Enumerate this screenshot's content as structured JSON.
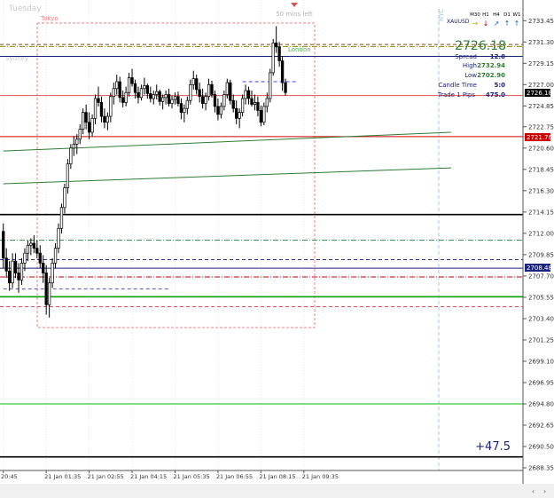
{
  "window": {
    "title": "Tuesday"
  },
  "sessions": [
    {
      "name": "Tokyo",
      "label": "Tokyo"
    },
    {
      "name": "Sydney",
      "label": "Sydney"
    },
    {
      "name": "London",
      "label": "London"
    },
    {
      "name": "NY",
      "label": "NYC"
    }
  ],
  "timer_text": "50 mins left",
  "symbol": "XAUUSD",
  "timeframes": [
    "M30",
    "H1",
    "H4",
    "D1",
    "W1"
  ],
  "timeframe_arrows": [
    "right",
    "down",
    "up-right",
    "up",
    "up"
  ],
  "info_panel": {
    "price": "2726.18",
    "rows": [
      {
        "label": "Spread",
        "value": "12.0"
      },
      {
        "label": "High",
        "value": "2732.94"
      },
      {
        "label": "Low",
        "value": "2702.90"
      },
      {
        "label": "Candle Time",
        "value": "5:0"
      },
      {
        "label": "Trade 1 Pips",
        "value": "475.0"
      }
    ]
  },
  "pnl_text": "+47.5",
  "current_price_label": "2726.18",
  "red_line_label": "2721.76",
  "blue_line_label": "2708.48",
  "colors": {
    "bull": "#000000",
    "bear": "#000000",
    "price_up": "#2e7d32",
    "axis_text": "#333333",
    "session_box": "#f08080",
    "current_price_bg": "#000000",
    "red_tag": "#cc0000",
    "navy_tag": "#1a237e",
    "nyc_line": "#9ecae1"
  },
  "chart_data": {
    "type": "candlestick",
    "symbol": "XAUUSD",
    "timeframe": "M5",
    "ylim": [
      2688.35,
      2735.0
    ],
    "y_ticks": [
      2733.45,
      2731.3,
      2729.15,
      2727.0,
      2724.85,
      2722.75,
      2720.6,
      2718.45,
      2716.3,
      2714.15,
      2712.0,
      2709.85,
      2707.7,
      2705.55,
      2703.4,
      2701.25,
      2699.1,
      2696.95,
      2694.8,
      2692.65,
      2690.5,
      2688.35
    ],
    "x_tick_labels": [
      "20:45",
      "21 Jan 01:35",
      "21 Jan 02:55",
      "21 Jan 04:15",
      "21 Jan 05:35",
      "21 Jan 06:55",
      "21 Jan 08:15",
      "21 Jan 09:35"
    ],
    "x_tick_bars": [
      0,
      14,
      28,
      42,
      56,
      70,
      84,
      98
    ],
    "candles": [
      [
        2712.2,
        2713.0,
        2708.5,
        2709.5
      ],
      [
        2709.5,
        2710.5,
        2707.5,
        2708.2
      ],
      [
        2708.2,
        2709.2,
        2706.2,
        2707.0
      ],
      [
        2707.0,
        2710.0,
        2706.5,
        2709.2
      ],
      [
        2709.2,
        2710.0,
        2707.5,
        2708.0
      ],
      [
        2708.0,
        2709.0,
        2706.0,
        2707.3
      ],
      [
        2707.3,
        2709.5,
        2706.8,
        2709.0
      ],
      [
        2709.0,
        2710.5,
        2708.2,
        2710.0
      ],
      [
        2710.0,
        2711.3,
        2709.2,
        2710.8
      ],
      [
        2710.8,
        2711.5,
        2709.8,
        2711.0
      ],
      [
        2711.0,
        2711.8,
        2710.0,
        2710.5
      ],
      [
        2710.5,
        2711.3,
        2709.5,
        2710.0
      ],
      [
        2710.0,
        2710.8,
        2708.5,
        2709.0
      ],
      [
        2709.0,
        2709.8,
        2707.0,
        2708.0
      ],
      [
        2708.0,
        2708.8,
        2703.8,
        2704.8
      ],
      [
        2704.8,
        2707.5,
        2703.5,
        2707.0
      ],
      [
        2707.0,
        2709.5,
        2706.5,
        2709.0
      ],
      [
        2709.0,
        2711.0,
        2708.5,
        2710.5
      ],
      [
        2710.5,
        2713.0,
        2710.0,
        2712.5
      ],
      [
        2712.5,
        2715.0,
        2712.0,
        2714.6
      ],
      [
        2714.6,
        2717.0,
        2714.0,
        2716.6
      ],
      [
        2716.6,
        2719.5,
        2716.0,
        2719.0
      ],
      [
        2719.0,
        2721.0,
        2718.5,
        2720.6
      ],
      [
        2720.6,
        2721.8,
        2719.8,
        2721.0
      ],
      [
        2721.0,
        2722.0,
        2720.0,
        2721.5
      ],
      [
        2721.5,
        2723.0,
        2721.0,
        2722.5
      ],
      [
        2722.5,
        2724.6,
        2722.0,
        2724.2
      ],
      [
        2724.2,
        2725.0,
        2722.5,
        2723.2
      ],
      [
        2723.2,
        2724.2,
        2721.5,
        2722.2
      ],
      [
        2722.2,
        2724.0,
        2721.8,
        2723.6
      ],
      [
        2723.6,
        2726.0,
        2723.0,
        2725.6
      ],
      [
        2725.6,
        2726.8,
        2724.8,
        2725.2
      ],
      [
        2725.2,
        2725.8,
        2723.2,
        2723.8
      ],
      [
        2723.8,
        2724.6,
        2722.6,
        2723.2
      ],
      [
        2723.2,
        2724.2,
        2722.4,
        2723.8
      ],
      [
        2723.8,
        2726.2,
        2723.2,
        2725.8
      ],
      [
        2725.8,
        2727.2,
        2725.0,
        2726.6
      ],
      [
        2726.6,
        2728.0,
        2726.0,
        2727.3
      ],
      [
        2727.3,
        2727.8,
        2725.2,
        2725.7
      ],
      [
        2725.7,
        2726.4,
        2724.7,
        2725.2
      ],
      [
        2725.2,
        2726.8,
        2724.8,
        2726.2
      ],
      [
        2726.2,
        2728.2,
        2725.8,
        2727.7
      ],
      [
        2727.7,
        2728.6,
        2726.8,
        2727.1
      ],
      [
        2727.1,
        2727.5,
        2725.6,
        2726.2
      ],
      [
        2726.2,
        2726.8,
        2725.1,
        2725.7
      ],
      [
        2725.7,
        2727.0,
        2725.4,
        2726.6
      ],
      [
        2726.6,
        2727.7,
        2726.0,
        2726.9
      ],
      [
        2726.9,
        2727.1,
        2725.6,
        2726.1
      ],
      [
        2726.1,
        2726.8,
        2725.2,
        2725.6
      ],
      [
        2725.6,
        2726.4,
        2725.0,
        2726.0
      ],
      [
        2726.0,
        2727.0,
        2725.5,
        2726.3
      ],
      [
        2726.3,
        2726.5,
        2724.9,
        2725.3
      ],
      [
        2725.3,
        2726.0,
        2724.5,
        2725.7
      ],
      [
        2725.7,
        2726.4,
        2725.0,
        2726.0
      ],
      [
        2726.0,
        2726.6,
        2724.8,
        2725.1
      ],
      [
        2725.1,
        2725.9,
        2724.6,
        2725.5
      ],
      [
        2725.5,
        2726.2,
        2725.0,
        2725.8
      ],
      [
        2725.8,
        2726.3,
        2724.8,
        2725.1
      ],
      [
        2725.1,
        2725.6,
        2723.5,
        2724.2
      ],
      [
        2724.2,
        2725.0,
        2723.2,
        2724.6
      ],
      [
        2724.6,
        2725.8,
        2724.0,
        2725.4
      ],
      [
        2725.4,
        2727.5,
        2725.0,
        2727.0
      ],
      [
        2727.0,
        2728.4,
        2726.5,
        2727.6
      ],
      [
        2727.6,
        2728.0,
        2726.0,
        2726.5
      ],
      [
        2726.5,
        2727.2,
        2725.2,
        2725.8
      ],
      [
        2725.8,
        2726.6,
        2724.6,
        2725.1
      ],
      [
        2725.1,
        2726.2,
        2724.4,
        2725.8
      ],
      [
        2725.8,
        2727.6,
        2725.4,
        2727.0
      ],
      [
        2727.0,
        2727.4,
        2725.7,
        2726.0
      ],
      [
        2726.0,
        2726.4,
        2724.2,
        2724.8
      ],
      [
        2724.8,
        2725.6,
        2723.4,
        2724.0
      ],
      [
        2724.0,
        2725.2,
        2723.6,
        2724.8
      ],
      [
        2724.8,
        2726.4,
        2724.4,
        2726.0
      ],
      [
        2726.0,
        2727.6,
        2725.6,
        2727.2
      ],
      [
        2727.2,
        2727.5,
        2725.0,
        2725.4
      ],
      [
        2725.4,
        2726.0,
        2724.2,
        2724.6
      ],
      [
        2724.6,
        2725.4,
        2723.0,
        2723.6
      ],
      [
        2723.6,
        2724.6,
        2722.6,
        2724.2
      ],
      [
        2724.2,
        2726.0,
        2723.8,
        2725.6
      ],
      [
        2725.6,
        2727.0,
        2725.0,
        2726.4
      ],
      [
        2726.4,
        2726.8,
        2725.0,
        2725.6
      ],
      [
        2725.6,
        2726.4,
        2724.8,
        2725.0
      ],
      [
        2725.0,
        2726.0,
        2724.4,
        2725.2
      ],
      [
        2725.2,
        2725.8,
        2723.8,
        2724.4
      ],
      [
        2724.4,
        2724.9,
        2722.8,
        2723.2
      ],
      [
        2723.2,
        2725.2,
        2722.9,
        2724.8
      ],
      [
        2724.8,
        2726.2,
        2724.2,
        2725.6
      ],
      [
        2725.6,
        2728.6,
        2725.2,
        2728.2
      ],
      [
        2728.2,
        2731.6,
        2727.9,
        2731.2
      ],
      [
        2731.2,
        2732.9,
        2730.2,
        2730.8
      ],
      [
        2730.8,
        2731.3,
        2728.8,
        2729.4
      ],
      [
        2729.4,
        2729.9,
        2726.4,
        2727.2
      ],
      [
        2727.2,
        2727.6,
        2725.9,
        2726.2
      ]
    ],
    "levels": [
      {
        "price": 2730.85,
        "color": "#8b8b00",
        "style": "dashdot"
      },
      {
        "price": 2731.05,
        "color": "#8b4513",
        "style": "dashed"
      },
      {
        "price": 2729.85,
        "color": "#1a237e",
        "style": "solid"
      },
      {
        "price": 2727.3,
        "color": "#4040ff",
        "style": "dashed",
        "x_range": [
          78,
          96
        ]
      },
      {
        "price": 2725.9,
        "color": "#e05050",
        "style": "solid"
      },
      {
        "price": 2721.76,
        "color": "#cc0000",
        "style": "solid"
      },
      {
        "price": 2713.9,
        "color": "#000000",
        "style": "solid",
        "thick": true
      },
      {
        "price": 2711.3,
        "color": "#2e8b57",
        "style": "dashdot"
      },
      {
        "price": 2709.35,
        "color": "#3030a0",
        "style": "dashed"
      },
      {
        "price": 2708.48,
        "color": "#1a237e",
        "style": "solid"
      },
      {
        "price": 2707.6,
        "color": "#cc0000",
        "style": "dashdot"
      },
      {
        "price": 2706.4,
        "color": "#5050c0",
        "style": "dashed",
        "x_range": [
          0,
          54
        ]
      },
      {
        "price": 2705.6,
        "color": "#00a000",
        "style": "solid",
        "thick": true
      },
      {
        "price": 2704.6,
        "color": "#e05050",
        "style": "dashed"
      },
      {
        "price": 2694.8,
        "color": "#00c000",
        "style": "solid"
      },
      {
        "price": 2689.45,
        "color": "#000000",
        "style": "solid",
        "thick": true
      }
    ],
    "trendlines": [
      {
        "x1": 0,
        "y1": 2720.3,
        "x2": 146,
        "y2": 2722.2,
        "color": "#2e7d32"
      },
      {
        "x1": 0,
        "y1": 2717.0,
        "x2": 146,
        "y2": 2718.6,
        "color": "#2e7d32"
      }
    ]
  }
}
